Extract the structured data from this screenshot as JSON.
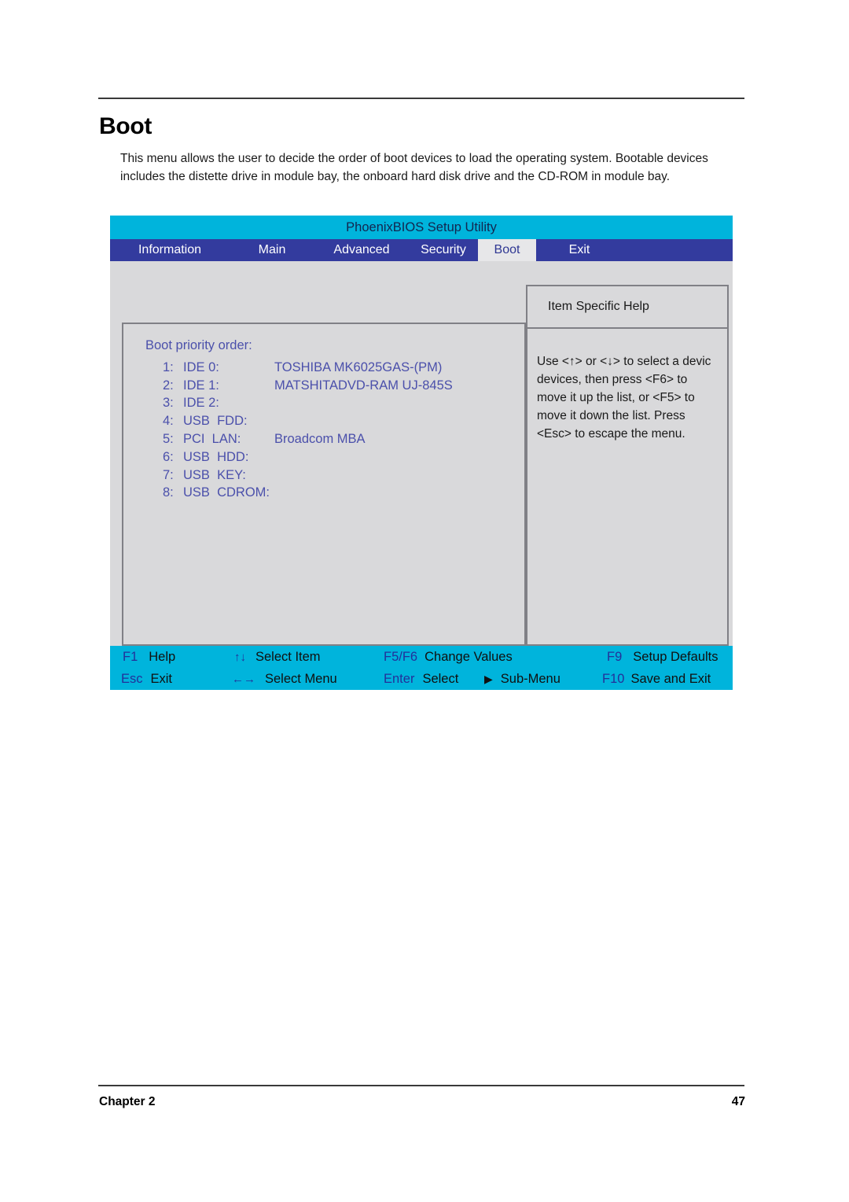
{
  "document": {
    "heading": "Boot",
    "intro": "This menu allows the user to decide the order of boot devices to load the operating system. Bootable devices includes the distette drive in module bay, the onboard hard disk drive and the CD-ROM in module bay.",
    "footer_chapter": "Chapter 2",
    "footer_page": "47"
  },
  "bios": {
    "title": "PhoenixBIOS Setup Utility",
    "menu_tabs": [
      {
        "label": "Information",
        "active": false
      },
      {
        "label": "Main",
        "active": false
      },
      {
        "label": "Advanced",
        "active": false
      },
      {
        "label": "Security",
        "active": false
      },
      {
        "label": "Boot",
        "active": true
      },
      {
        "label": "Exit",
        "active": false
      }
    ],
    "boot_priority": {
      "heading": "Boot priority order:",
      "items": [
        {
          "index": "1:",
          "device": "IDE 0:",
          "value": "TOSHIBA MK6025GAS-(PM)"
        },
        {
          "index": "2:",
          "device": "IDE 1:",
          "value": "MATSHITADVD-RAM UJ-845S"
        },
        {
          "index": "3:",
          "device": "IDE 2:",
          "value": ""
        },
        {
          "index": "4:",
          "device": "USB  FDD:",
          "value": ""
        },
        {
          "index": "5:",
          "device": "PCI  LAN:",
          "value": "Broadcom MBA"
        },
        {
          "index": "6:",
          "device": "USB  HDD:",
          "value": ""
        },
        {
          "index": "7:",
          "device": "USB  KEY:",
          "value": ""
        },
        {
          "index": "8:",
          "device": "USB  CDROM:",
          "value": ""
        }
      ]
    },
    "help": {
      "title": "Item Specific Help",
      "lines": [
        "Use <↑> or <↓> to select a devic",
        "devices, then press <F6> to",
        "move it up the list, or <F5> to",
        "move it down the list. Press",
        "<Esc> to escape the menu."
      ]
    },
    "key_bar": {
      "row1": [
        {
          "key": "F1",
          "desc": "Help"
        },
        {
          "key": "↑↓",
          "desc": "Select Item"
        },
        {
          "key": "F5/F6",
          "desc": "Change Values"
        },
        {
          "key": "F9",
          "desc": "Setup Defaults"
        }
      ],
      "row2": [
        {
          "key": "Esc",
          "desc": "Exit"
        },
        {
          "key": "←→",
          "desc": "Select Menu"
        },
        {
          "key": "Enter",
          "desc": "Select"
        },
        {
          "key": "▶",
          "desc": "Sub-Menu"
        },
        {
          "key": "F10",
          "desc": "Save and Exit"
        }
      ]
    }
  },
  "colors": {
    "titlebar": "#00b4dc",
    "menubar": "#333b9e",
    "body": "#d9d9db",
    "accent_text": "#4b50ab",
    "key_name": "#23309a",
    "active_tab_bg": "#e7e7e9"
  }
}
